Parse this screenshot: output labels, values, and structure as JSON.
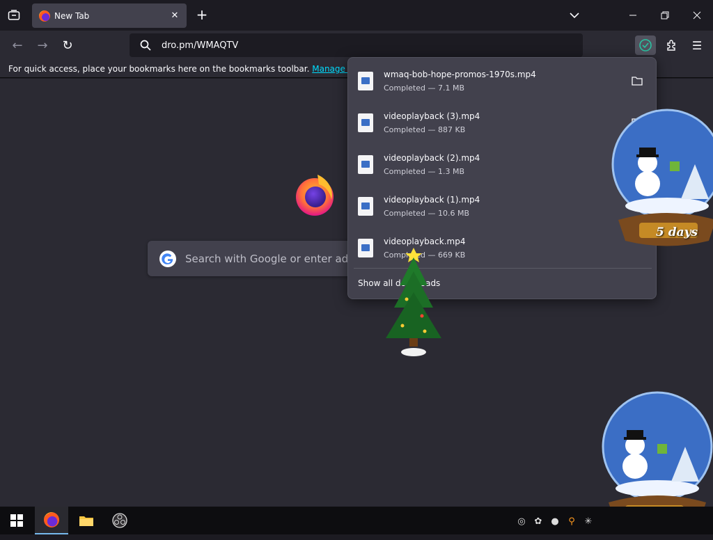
{
  "tab": {
    "title": "New Tab"
  },
  "toolbar": {
    "url": "dro.pm/WMAQTV"
  },
  "bookmarks": {
    "message": "For quick access, place your bookmarks here on the bookmarks toolbar.",
    "manage_link": "Manage bookmarks…"
  },
  "newtab": {
    "search_placeholder": "Search with Google or enter address"
  },
  "downloads": {
    "items": [
      {
        "name": "wmaq-bob-hope-promos-1970s.mp4",
        "status": "Completed — 7.1 MB"
      },
      {
        "name": "videoplayback (3).mp4",
        "status": "Completed — 887 KB"
      },
      {
        "name": "videoplayback (2).mp4",
        "status": "Completed — 1.3 MB"
      },
      {
        "name": "videoplayback (1).mp4",
        "status": "Completed — 10.6 MB"
      },
      {
        "name": "videoplayback.mp4",
        "status": "Completed — 669 KB"
      }
    ],
    "show_all": "Show all downloads"
  },
  "overlay": {
    "globe_label": "5 days"
  },
  "colors": {
    "accent": "#00ddff",
    "toolbar": "#2b2a33",
    "panel": "#42414d",
    "tabstrip": "#1c1b22"
  },
  "icons": [
    "list-all-tabs-icon",
    "firefox-icon",
    "close-icon",
    "plus-icon",
    "chevron-down-icon",
    "minimize-icon",
    "restore-icon",
    "back-icon",
    "forward-icon",
    "reload-icon",
    "search-icon",
    "download-done-icon",
    "extensions-icon",
    "hamburger-menu-icon",
    "video-file-icon",
    "folder-icon",
    "windows-start-icon",
    "file-explorer-icon",
    "obs-icon"
  ]
}
